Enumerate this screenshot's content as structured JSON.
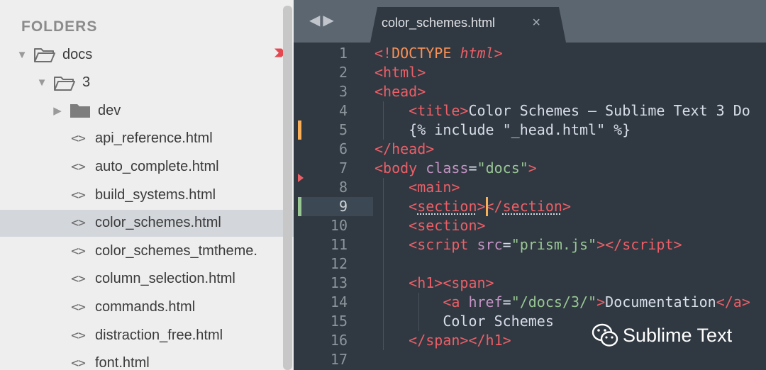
{
  "sidebar": {
    "header": "FOLDERS",
    "rows": [
      {
        "label": "docs",
        "kind": "folder-open",
        "expanded": true,
        "level": 0,
        "status": "modified-marker"
      },
      {
        "label": "3",
        "kind": "folder-open",
        "expanded": true,
        "level": 1,
        "status": "modified-marker"
      },
      {
        "label": "dev",
        "kind": "folder-closed",
        "expanded": false,
        "level": 2,
        "status": ""
      },
      {
        "label": "api_reference.html",
        "kind": "file",
        "level": 2,
        "status": ""
      },
      {
        "label": "auto_complete.html",
        "kind": "file",
        "level": 2,
        "status": ""
      },
      {
        "label": "build_systems.html",
        "kind": "file",
        "level": 2,
        "status": ""
      },
      {
        "label": "color_schemes.html",
        "kind": "file",
        "level": 2,
        "status": "open-dot",
        "selected": true
      },
      {
        "label": "color_schemes_tmtheme.",
        "kind": "file",
        "level": 2,
        "status": ""
      },
      {
        "label": "column_selection.html",
        "kind": "file",
        "level": 2,
        "status": ""
      },
      {
        "label": "commands.html",
        "kind": "file",
        "level": 2,
        "status": "hollow-dot"
      },
      {
        "label": "distraction_free.html",
        "kind": "file",
        "level": 2,
        "status": ""
      },
      {
        "label": "font.html",
        "kind": "file",
        "level": 2,
        "status": ""
      }
    ],
    "file_icon_glyph": "<>"
  },
  "tabbar": {
    "nav_back": "◀",
    "nav_forward": "▶",
    "active_tab": {
      "title": "color_schemes.html",
      "close_glyph": "×"
    }
  },
  "editor": {
    "current_line": 9,
    "lines": [
      {
        "n": "1",
        "html": "<span class=\"t\">&lt;!</span><span class=\"d\">DOCTYPE</span> <span class=\"i\">html</span><span class=\"t\">&gt;</span>"
      },
      {
        "n": "2",
        "html": "<span class=\"t\">&lt;html&gt;</span>"
      },
      {
        "n": "3",
        "html": "<span class=\"t\">&lt;head&gt;</span>"
      },
      {
        "n": "4",
        "html": "    <span class=\"t\">&lt;title&gt;</span>Color Schemes – Sublime Text 3 Do"
      },
      {
        "n": "5",
        "html": "    {% include \"_head.html\" %}",
        "mark": "#f9ae58"
      },
      {
        "n": "6",
        "html": "<span class=\"t\">&lt;/head&gt;</span>"
      },
      {
        "n": "7",
        "html": "<span class=\"t\">&lt;body</span> <span class=\"a\">class</span>=<span class=\"s\">\"docs\"</span><span class=\"t\">&gt;</span>",
        "mark": "#ec5f67",
        "mark_kind": "triangle"
      },
      {
        "n": "8",
        "html": "    <span class=\"t\">&lt;main&gt;</span>"
      },
      {
        "n": "9",
        "html": "    <span class=\"t\">&lt;<span class=\"u\">section</span>&gt;&lt;/<span class=\"u\">section</span>&gt;</span>",
        "mark": "#99c794"
      },
      {
        "n": "10",
        "html": "    <span class=\"t\">&lt;section&gt;</span>"
      },
      {
        "n": "11",
        "html": "    <span class=\"t\">&lt;script</span> <span class=\"a\">src</span>=<span class=\"s\">\"prism.js\"</span><span class=\"t\">&gt;&lt;/script&gt;</span>"
      },
      {
        "n": "12",
        "html": ""
      },
      {
        "n": "13",
        "html": "    <span class=\"t\">&lt;h1&gt;&lt;span&gt;</span>"
      },
      {
        "n": "14",
        "html": "        <span class=\"t\">&lt;a</span> <span class=\"a\">href</span>=<span class=\"s\">\"/docs/3/\"</span><span class=\"t\">&gt;</span>Documentation<span class=\"t\">&lt;/a&gt;</span>"
      },
      {
        "n": "15",
        "html": "        Color Schemes"
      },
      {
        "n": "16",
        "html": "    <span class=\"t\">&lt;/span&gt;&lt;/h1&gt;</span>"
      },
      {
        "n": "17",
        "html": ""
      }
    ]
  },
  "watermark": {
    "text": "Sublime Text"
  },
  "colors": {
    "sidebar_bg": "#eeeeee",
    "editor_bg": "#303841",
    "tabbar_bg": "#5c6670",
    "tag": "#ec5f67",
    "attr": "#c594c5",
    "string": "#99c794",
    "cursor": "#f9ae58",
    "open_dot": "#5f94d4"
  }
}
